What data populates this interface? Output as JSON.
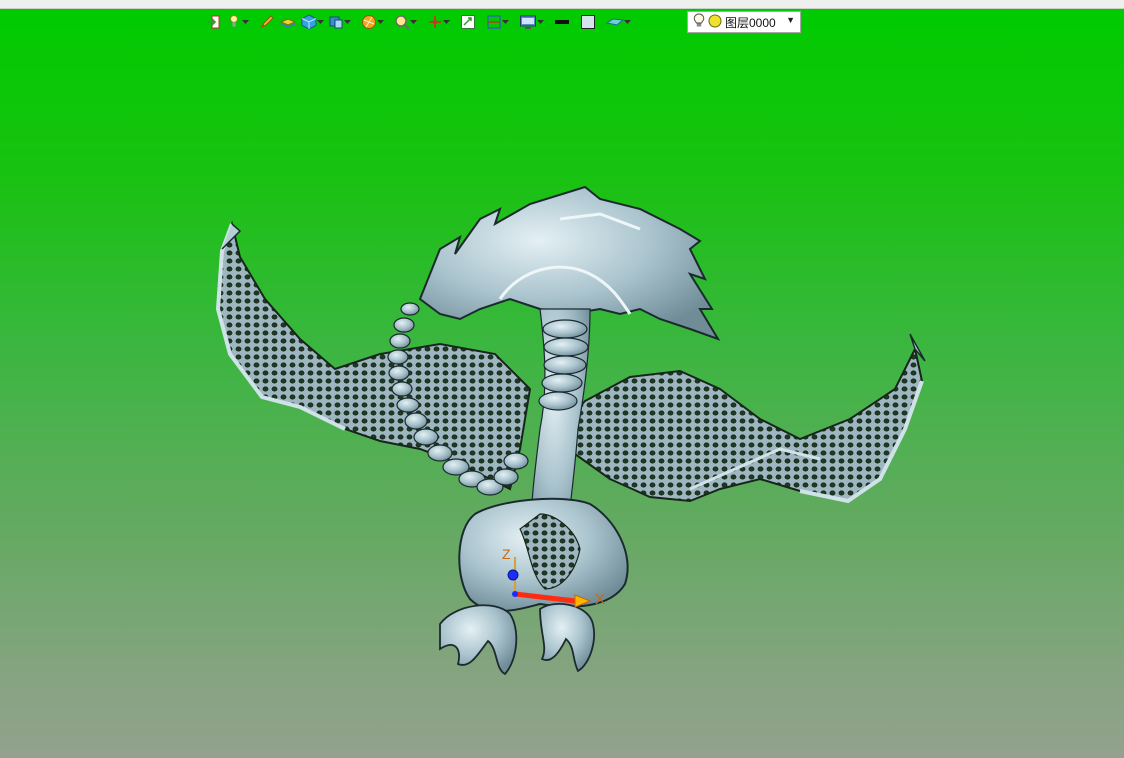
{
  "toolbar": {
    "items": [
      {
        "name": "exit-sketch-icon",
        "has_dropdown": false
      },
      {
        "name": "light-bulb-pin-icon",
        "has_dropdown": true
      },
      {
        "name": "pencil-icon",
        "has_dropdown": false
      },
      {
        "name": "layer-stack-icon",
        "has_dropdown": false
      },
      {
        "name": "cube-icon",
        "has_dropdown": true
      },
      {
        "name": "view-cube-icon",
        "has_dropdown": true
      },
      {
        "name": "shading-ball-icon",
        "has_dropdown": true
      },
      {
        "name": "zoom-magnifier-icon",
        "has_dropdown": true
      },
      {
        "name": "axis-triad-icon",
        "has_dropdown": true
      },
      {
        "name": "fit-view-icon",
        "has_dropdown": false
      },
      {
        "name": "section-view-icon",
        "has_dropdown": true
      },
      {
        "name": "display-monitor-icon",
        "has_dropdown": true
      },
      {
        "name": "line-color-swatch-icon",
        "has_dropdown": false
      },
      {
        "name": "fill-color-swatch-icon",
        "has_dropdown": false
      },
      {
        "name": "layer-plane-icon",
        "has_dropdown": true
      }
    ],
    "layer_dropdown": {
      "value": "图层0000",
      "bulb_icon": "light-bulb-icon",
      "status_icon": "layer-status-dot-icon",
      "caret_icon": "chevron-down-icon"
    }
  },
  "triad": {
    "x_label": "X",
    "z_label": "Z"
  },
  "colors": {
    "background_top": "#00cb00",
    "background_bottom": "#93a28e",
    "model": "#a9c3cd",
    "model_edge": "#1b2a2e",
    "x_axis": "#ff2a10",
    "z_axis": "#1a2cff"
  }
}
